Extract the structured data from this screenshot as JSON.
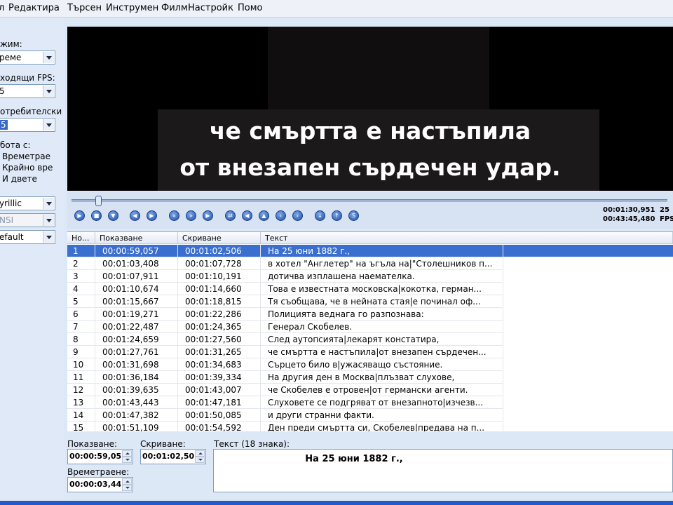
{
  "menu": [
    "л",
    "Редактира",
    "Търсен",
    "Инструмен",
    "Филм",
    "Настройк",
    "Помо"
  ],
  "left_panel": {
    "mode_label": "жим:",
    "mode_value": "реме",
    "fps_label": "ходящи FPS:",
    "fps_value": "5",
    "custom_label": "отребителски",
    "custom_value": "5",
    "work_label": "бота с:",
    "work_options": [
      "Времетрае",
      "Крайно вре",
      "И двете"
    ],
    "encoding_value": "yrillic",
    "encoding2_value": "NSI",
    "profile_value": "efault"
  },
  "video": {
    "subtitle_lines": [
      "че смъртта е настъпила",
      "от внезапен сърдечен удар."
    ]
  },
  "player": {
    "current_time": "00:01:30,951",
    "total_time": "00:43:45,480",
    "fps_value": "25",
    "fps_label": "FPS"
  },
  "grid": {
    "columns": [
      "Но...",
      "Показване",
      "Скриване",
      "Текст"
    ],
    "selected_index": 0,
    "rows": [
      [
        "1",
        "00:00:59,057",
        "00:01:02,506",
        "На 25 юни 1882 г.,"
      ],
      [
        "2",
        "00:01:03,408",
        "00:01:07,728",
        "в хотел \"Англетер\" на ъгъла на|\"Столешников п..."
      ],
      [
        "3",
        "00:01:07,911",
        "00:01:10,191",
        "дотичва изплашена наемателка."
      ],
      [
        "4",
        "00:01:10,674",
        "00:01:14,660",
        "Това е известната московска|кокотка,  герман..."
      ],
      [
        "5",
        "00:01:15,667",
        "00:01:18,815",
        "Тя съобщава, че в нейната стая|е починал оф..."
      ],
      [
        "6",
        "00:01:19,271",
        "00:01:22,286",
        "Полицията веднага го разпознава:"
      ],
      [
        "7",
        "00:01:22,487",
        "00:01:24,365",
        "Генерал Скобелев."
      ],
      [
        "8",
        "00:01:24,659",
        "00:01:27,560",
        "След аутопсията|лекарят констатира,"
      ],
      [
        "9",
        "00:01:27,761",
        "00:01:31,265",
        "че смъртта е настъпила|от внезапен сърдечен..."
      ],
      [
        "10",
        "00:01:31,698",
        "00:01:34,683",
        "Сърцето било в|ужасяващо състояние."
      ],
      [
        "11",
        "00:01:36,184",
        "00:01:39,334",
        "На другия ден в Москва|плъзват слухове,"
      ],
      [
        "12",
        "00:01:39,635",
        "00:01:43,007",
        "че Скобелев е отровен|от германски агенти."
      ],
      [
        "13",
        "00:01:43,443",
        "00:01:47,181",
        "Слуховете се подгряват от внезапното|изчезв..."
      ],
      [
        "14",
        "00:01:47,382",
        "00:01:50,085",
        "и други странни факти."
      ],
      [
        "15",
        "00:01:51,109",
        "00:01:54,592",
        "Ден преди смъртта си, Скобелев|предава на п..."
      ]
    ]
  },
  "editor": {
    "show_label": "Показване:",
    "show_value": "00:00:59,05",
    "hide_label": "Скриване:",
    "hide_value": "00:01:02,50",
    "duration_label": "Времетраене:",
    "duration_value": "00:00:03,44",
    "text_label": "Текст (18 знака):",
    "text_value": "На 25 юни 1882 г.,"
  }
}
